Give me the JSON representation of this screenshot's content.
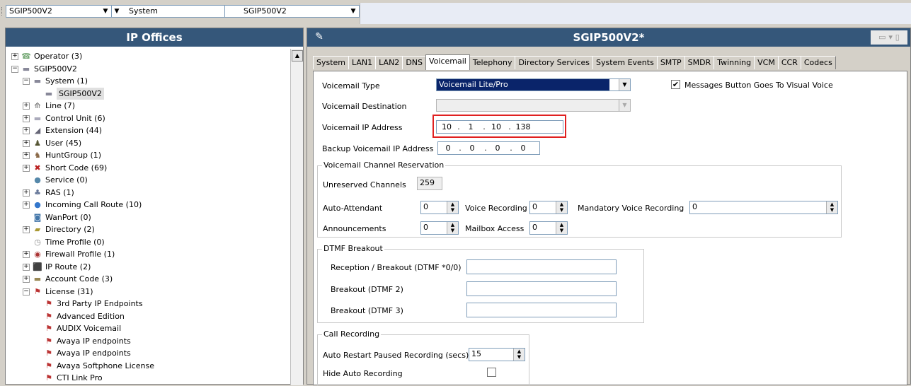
{
  "toolbar": {
    "combo1": "SGIP500V2",
    "combo2": "System",
    "combo3": "SGIP500V2"
  },
  "left_panel": {
    "title": "IP Offices",
    "tree": [
      {
        "label": "Operator (3)",
        "depth": 0,
        "expand": "+",
        "icon": "operator-icon",
        "glyph": "☎",
        "color": "#7a7"
      },
      {
        "label": "SGIP500V2",
        "depth": 0,
        "expand": "-",
        "icon": "ipoffice-icon",
        "glyph": "▬",
        "color": "#889"
      },
      {
        "label": "System (1)",
        "depth": 1,
        "expand": "-",
        "icon": "system-icon",
        "glyph": "▬",
        "color": "#889"
      },
      {
        "label": "SGIP500V2",
        "depth": 2,
        "expand": "",
        "icon": "system-unit-icon",
        "glyph": "▬",
        "color": "#889",
        "selected": true
      },
      {
        "label": "Line (7)",
        "depth": 1,
        "expand": "+",
        "icon": "line-icon",
        "glyph": "⟰",
        "color": "#666"
      },
      {
        "label": "Control Unit (6)",
        "depth": 1,
        "expand": "+",
        "icon": "control-unit-icon",
        "glyph": "▬",
        "color": "#aab"
      },
      {
        "label": "Extension (44)",
        "depth": 1,
        "expand": "+",
        "icon": "extension-icon",
        "glyph": "◢",
        "color": "#667"
      },
      {
        "label": "User (45)",
        "depth": 1,
        "expand": "+",
        "icon": "user-icon",
        "glyph": "♟",
        "color": "#553"
      },
      {
        "label": "HuntGroup (1)",
        "depth": 1,
        "expand": "+",
        "icon": "huntgroup-icon",
        "glyph": "♞",
        "color": "#864"
      },
      {
        "label": "Short Code (69)",
        "depth": 1,
        "expand": "+",
        "icon": "shortcode-icon",
        "glyph": "✖",
        "color": "#b22"
      },
      {
        "label": "Service (0)",
        "depth": 1,
        "expand": "",
        "icon": "service-icon",
        "glyph": "●",
        "color": "#58a"
      },
      {
        "label": "RAS (1)",
        "depth": 1,
        "expand": "+",
        "icon": "ras-icon",
        "glyph": "♣",
        "color": "#679"
      },
      {
        "label": "Incoming Call Route (10)",
        "depth": 1,
        "expand": "+",
        "icon": "incoming-call-route-icon",
        "glyph": "●",
        "color": "#37c"
      },
      {
        "label": "WanPort (0)",
        "depth": 1,
        "expand": "",
        "icon": "wanport-icon",
        "glyph": "◙",
        "color": "#47a"
      },
      {
        "label": "Directory (2)",
        "depth": 1,
        "expand": "+",
        "icon": "directory-icon",
        "glyph": "▰",
        "color": "#a93"
      },
      {
        "label": "Time Profile (0)",
        "depth": 1,
        "expand": "",
        "icon": "time-profile-icon",
        "glyph": "◷",
        "color": "#888"
      },
      {
        "label": "Firewall Profile (1)",
        "depth": 1,
        "expand": "+",
        "icon": "firewall-profile-icon",
        "glyph": "◉",
        "color": "#a33"
      },
      {
        "label": "IP Route (2)",
        "depth": 1,
        "expand": "+",
        "icon": "ip-route-icon",
        "glyph": "⬛",
        "color": "#b33"
      },
      {
        "label": "Account Code (3)",
        "depth": 1,
        "expand": "+",
        "icon": "account-code-icon",
        "glyph": "▬",
        "color": "#985"
      },
      {
        "label": "License (31)",
        "depth": 1,
        "expand": "-",
        "icon": "license-icon",
        "glyph": "⚑",
        "color": "#b33"
      },
      {
        "label": "3rd Party IP Endpoints",
        "depth": 2,
        "expand": "",
        "icon": "license-key-icon",
        "glyph": "⚑",
        "color": "#b33"
      },
      {
        "label": "Advanced Edition",
        "depth": 2,
        "expand": "",
        "icon": "license-key-icon",
        "glyph": "⚑",
        "color": "#b33"
      },
      {
        "label": "AUDIX Voicemail",
        "depth": 2,
        "expand": "",
        "icon": "license-key-icon",
        "glyph": "⚑",
        "color": "#b33"
      },
      {
        "label": "Avaya IP endpoints",
        "depth": 2,
        "expand": "",
        "icon": "license-key-icon",
        "glyph": "⚑",
        "color": "#b33"
      },
      {
        "label": "Avaya IP endpoints",
        "depth": 2,
        "expand": "",
        "icon": "license-key-icon",
        "glyph": "⚑",
        "color": "#b33"
      },
      {
        "label": "Avaya Softphone License",
        "depth": 2,
        "expand": "",
        "icon": "license-key-icon",
        "glyph": "⚑",
        "color": "#b33"
      },
      {
        "label": "CTI Link Pro",
        "depth": 2,
        "expand": "",
        "icon": "license-key-icon",
        "glyph": "⚑",
        "color": "#b33"
      }
    ]
  },
  "right_panel": {
    "title": "SGIP500V2*",
    "tabs": [
      "System",
      "LAN1",
      "LAN2",
      "DNS",
      "Voicemail",
      "Telephony",
      "Directory Services",
      "System Events",
      "SMTP",
      "SMDR",
      "Twinning",
      "VCM",
      "CCR",
      "Codecs"
    ],
    "active_tab": "Voicemail",
    "voicemail": {
      "type_label": "Voicemail Type",
      "type_value": "Voicemail Lite/Pro",
      "visual_voice_label": "Messages Button Goes To Visual Voice",
      "visual_voice_checked": true,
      "destination_label": "Voicemail Destination",
      "destination_value": "",
      "ip_label": "Voicemail IP Address",
      "ip": [
        "10",
        "1",
        "10",
        "138"
      ],
      "backup_ip_label": "Backup Voicemail IP Address",
      "backup_ip": [
        "0",
        "0",
        "0",
        "0"
      ]
    },
    "channel_reservation": {
      "title": "Voicemail Channel Reservation",
      "unreserved_label": "Unreserved Channels",
      "unreserved_value": "259",
      "auto_attendant_label": "Auto-Attendant",
      "auto_attendant_value": "0",
      "voice_recording_label": "Voice Recording",
      "voice_recording_value": "0",
      "mandatory_label": "Mandatory Voice Recording",
      "mandatory_value": "0",
      "announcements_label": "Announcements",
      "announcements_value": "0",
      "mailbox_label": "Mailbox Access",
      "mailbox_value": "0"
    },
    "dtmf": {
      "title": "DTMF Breakout",
      "reception_label": "Reception / Breakout (DTMF *0/0)",
      "reception_value": "",
      "breakout2_label": "Breakout (DTMF 2)",
      "breakout2_value": "",
      "breakout3_label": "Breakout (DTMF 3)",
      "breakout3_value": ""
    },
    "call_recording": {
      "title": "Call Recording",
      "auto_restart_label": "Auto Restart Paused Recording (secs)",
      "auto_restart_value": "15",
      "hide_label": "Hide Auto Recording",
      "hide_checked": false
    }
  }
}
